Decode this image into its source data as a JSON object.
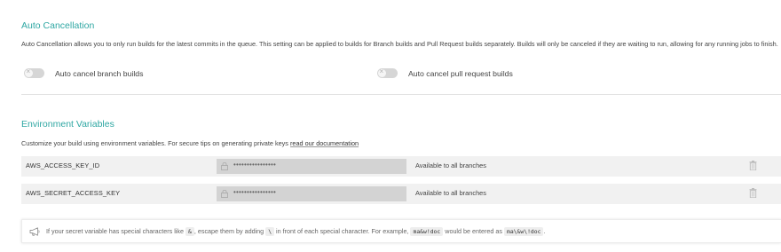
{
  "auto_cancellation": {
    "title": "Auto Cancellation",
    "description": "Auto Cancellation allows you to only run builds for the latest commits in the queue. This setting can be applied to builds for Branch builds and Pull Request builds separately. Builds will only be canceled if they are waiting to run, allowing for any running jobs to finish.",
    "branch_toggle_label": "Auto cancel branch builds",
    "branch_toggle_on": false,
    "pr_toggle_label": "Auto cancel pull request builds",
    "pr_toggle_on": false
  },
  "env_vars": {
    "title": "Environment Variables",
    "description_prefix": "Customize your build using environment variables. For secure tips on generating private keys",
    "docs_link": "read our documentation",
    "rows": [
      {
        "name": "AWS_ACCESS_KEY_ID",
        "value_masked": "••••••••••••••••",
        "branches": "Available to all branches"
      },
      {
        "name": "AWS_SECRET_ACCESS_KEY",
        "value_masked": "••••••••••••••••",
        "branches": "Available to all branches"
      }
    ]
  },
  "notice": {
    "text_1": "If your secret variable has special characters like",
    "code_1": "&",
    "text_2": ", escape them by adding",
    "code_2": "\\",
    "text_3": "in front of each special character. For example,",
    "code_3": "ma&w!doc",
    "text_4": "would be entered as",
    "code_4": "ma\\&w\\!doc",
    "text_5": "."
  },
  "colors": {
    "accent": "#2fa7a3",
    "row_bg": "#f1f1f1",
    "value_bg": "#d3d3d3"
  },
  "icons": [
    "lock-icon",
    "trash-icon",
    "megaphone-icon"
  ]
}
